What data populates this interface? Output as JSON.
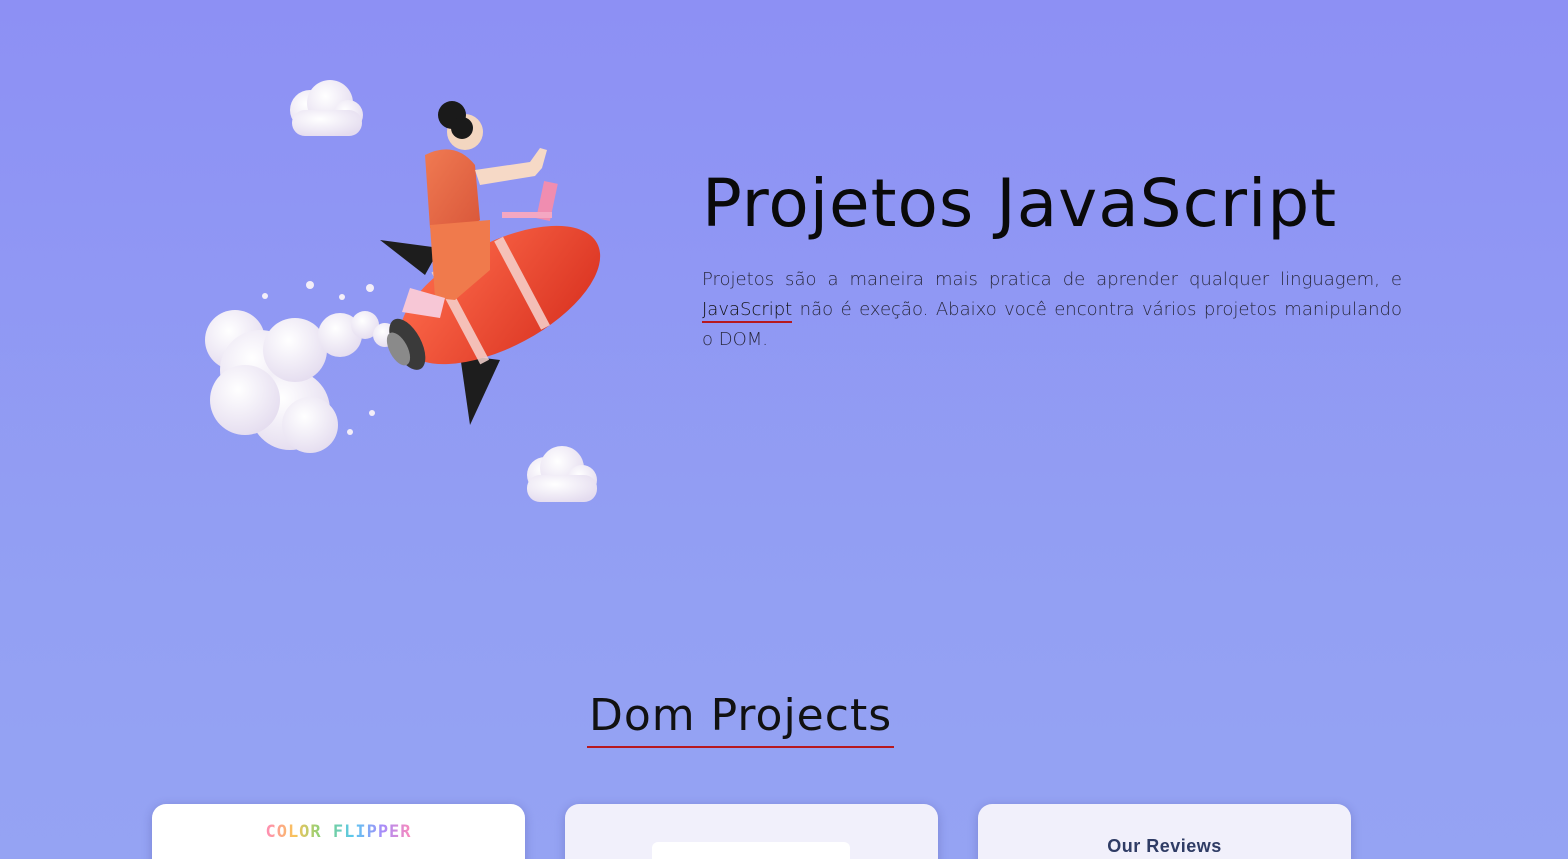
{
  "hero": {
    "title": "Projetos JavaScript",
    "desc_before": "Projetos são a maneira mais pratica de aprender qualquer linguagem, e ",
    "desc_link": "JavaScript",
    "desc_after": " não é exeção. Abaixo você encontra vários projetos manipulando o DOM.",
    "illustration_icon": "rocket-rider-illustration"
  },
  "section": {
    "title": "Dom Projects"
  },
  "cards": [
    {
      "logo_text": "COLOR FLIPPER"
    },
    {
      "label": ""
    },
    {
      "title": "Our Reviews"
    }
  ],
  "colors": {
    "accent_underline": "#b7191f",
    "background": "#8d90f4"
  }
}
